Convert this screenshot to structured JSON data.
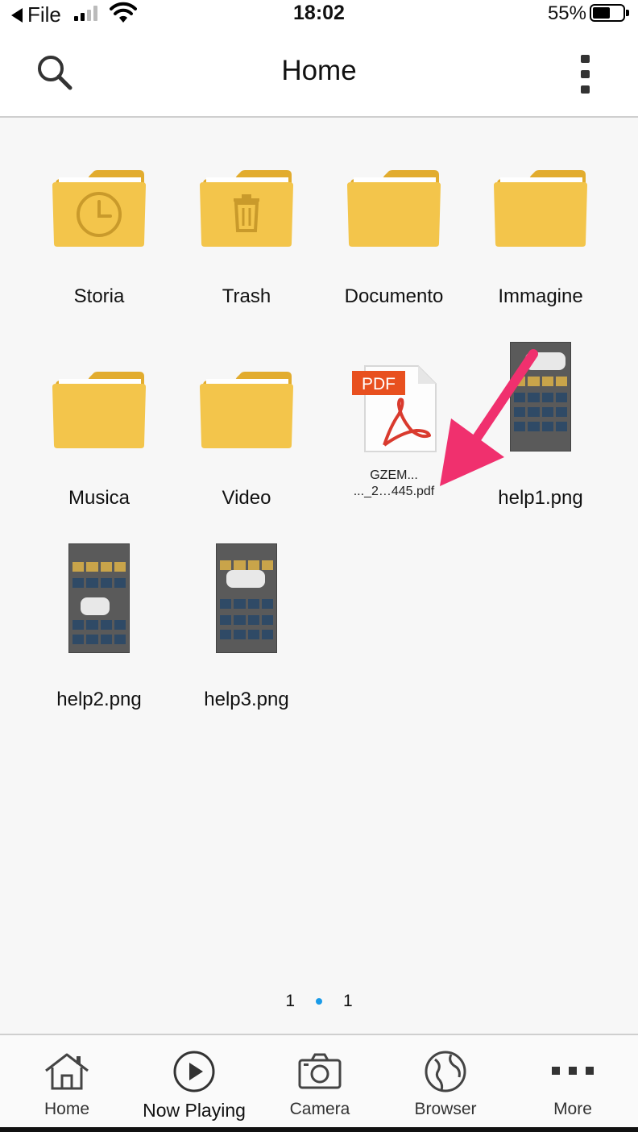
{
  "status_bar": {
    "back_label": "File",
    "time": "18:02",
    "battery_percent": "55%",
    "battery_level": 0.55
  },
  "header": {
    "title": "Home"
  },
  "items": [
    {
      "label": "Storia",
      "kind": "folder",
      "badge": "clock-icon"
    },
    {
      "label": "Trash",
      "kind": "folder",
      "badge": "trash-icon"
    },
    {
      "label": "Documento",
      "kind": "folder"
    },
    {
      "label": "Immagine",
      "kind": "folder"
    },
    {
      "label": "Musica",
      "kind": "folder"
    },
    {
      "label": "Video",
      "kind": "folder"
    },
    {
      "label_line1": "GZEM...",
      "label_line2": "..._2…445.pdf",
      "kind": "pdf",
      "badge_text": "PDF"
    },
    {
      "label": "help1.png",
      "kind": "image"
    },
    {
      "label": "help2.png",
      "kind": "image"
    },
    {
      "label": "help3.png",
      "kind": "image"
    }
  ],
  "pager": {
    "left": "1",
    "right": "1"
  },
  "tabbar": {
    "home": "Home",
    "now_playing": "Now Playing",
    "camera": "Camera",
    "browser": "Browser",
    "more": "More"
  },
  "colors": {
    "folder": "#f3c54b",
    "accent_arrow": "#f0306e",
    "pager_dot": "#1a9be8",
    "pdf_badge": "#e8501f"
  }
}
